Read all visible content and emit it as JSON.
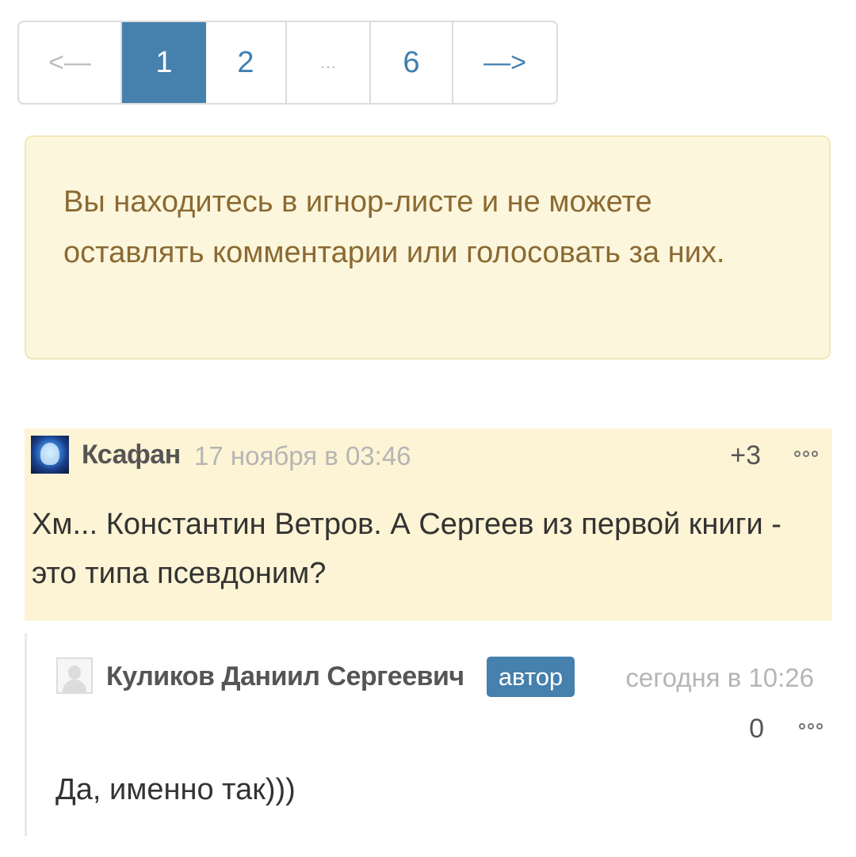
{
  "pagination": {
    "prev_label": "<—",
    "pages": [
      "1",
      "2",
      "…",
      "6"
    ],
    "current": "1",
    "next_label": "—>"
  },
  "notice": {
    "text": "Вы находитесь в игнор-листе и не можете оставлять комментарии или голосовать за них."
  },
  "comments": [
    {
      "author": "Ксафан",
      "date": "17 ноября в 03:46",
      "score": "+3",
      "text": "Хм... Константин Ветров. А Сергеев из первой книги - это типа псевдоним?"
    }
  ],
  "reply": {
    "author": "Куликов Даниил Сергеевич",
    "badge": "автор",
    "date": "сегодня в 10:26",
    "score": "0",
    "text": "Да, именно так)))"
  },
  "colors": {
    "accent": "#4680ad",
    "link": "#3f7fb1",
    "notice_bg": "#fcf6dd",
    "notice_text": "#8b6a32",
    "highlight_bg": "#fcf4d4"
  },
  "icons": [
    "ellipsis-icon",
    "avatar-image",
    "default-avatar-icon"
  ]
}
